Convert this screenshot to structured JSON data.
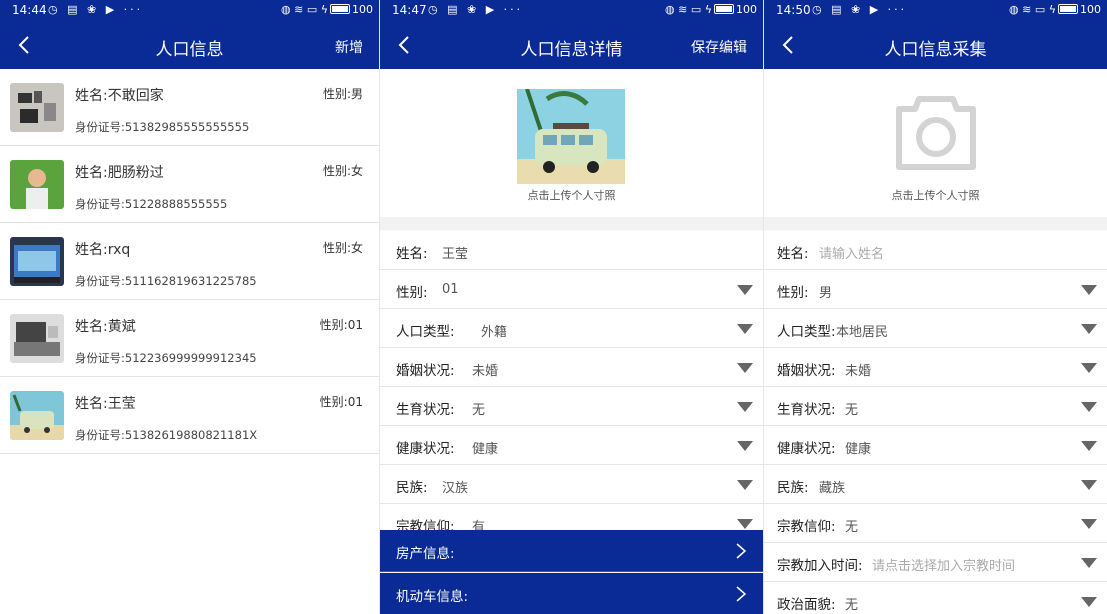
{
  "panel1": {
    "status": {
      "time": "14:44",
      "battery": "100"
    },
    "nav": {
      "title": "人口信息",
      "action": "新增"
    },
    "people": [
      {
        "name": "姓名:不敢回家",
        "id": "身份证号:51382985555555555",
        "gender": "性别:男"
      },
      {
        "name": "姓名:肥肠粉过",
        "id": "身份证号:51228888555555",
        "gender": "性别:女"
      },
      {
        "name": "姓名:rxq",
        "id": "身份证号:511162819631225785",
        "gender": "性别:女"
      },
      {
        "name": "姓名:黄斌",
        "id": "身份证号:512236999999912345",
        "gender": "性别:01"
      },
      {
        "name": "姓名:王莹",
        "id": "身份证号:51382619880821181X",
        "gender": "性别:01"
      }
    ]
  },
  "panel2": {
    "status": {
      "time": "14:47",
      "battery": "100"
    },
    "nav": {
      "title": "人口信息详情",
      "action": "保存编辑"
    },
    "photo_caption": "点击上传个人寸照",
    "fields": [
      {
        "label": "姓名:",
        "value": "王莹"
      },
      {
        "label": "性别:",
        "value": "01"
      },
      {
        "label": "人口类型:",
        "value": "外籍"
      },
      {
        "label": "婚姻状况:",
        "value": "未婚"
      },
      {
        "label": "生育状况:",
        "value": "无"
      },
      {
        "label": "健康状况:",
        "value": "健康"
      },
      {
        "label": "民族:",
        "value": "汉族"
      },
      {
        "label": "宗教信仰:",
        "value": "有"
      }
    ],
    "bottom": [
      {
        "label": "房产信息:"
      },
      {
        "label": "机动车信息:"
      }
    ]
  },
  "panel3": {
    "status": {
      "time": "14:50",
      "battery": "100"
    },
    "nav": {
      "title": "人口信息采集"
    },
    "photo_caption": "点击上传个人寸照",
    "fields": [
      {
        "label": "姓名:",
        "placeholder": "请输入姓名"
      },
      {
        "label": "性别:",
        "value": "男"
      },
      {
        "label": "人口类型:",
        "value": "本地居民"
      },
      {
        "label": "婚姻状况:",
        "value": "未婚"
      },
      {
        "label": "生育状况:",
        "value": "无"
      },
      {
        "label": "健康状况:",
        "value": "健康"
      },
      {
        "label": "民族:",
        "value": "藏族"
      },
      {
        "label": "宗教信仰:",
        "value": "无"
      },
      {
        "label": "宗教加入时间:",
        "placeholder": "请点击选择加入宗教时间"
      },
      {
        "label": "政治面貌:",
        "value": "无"
      }
    ]
  },
  "colors": {
    "primary": "#0a2b96",
    "divider": "#e6e6e6"
  }
}
